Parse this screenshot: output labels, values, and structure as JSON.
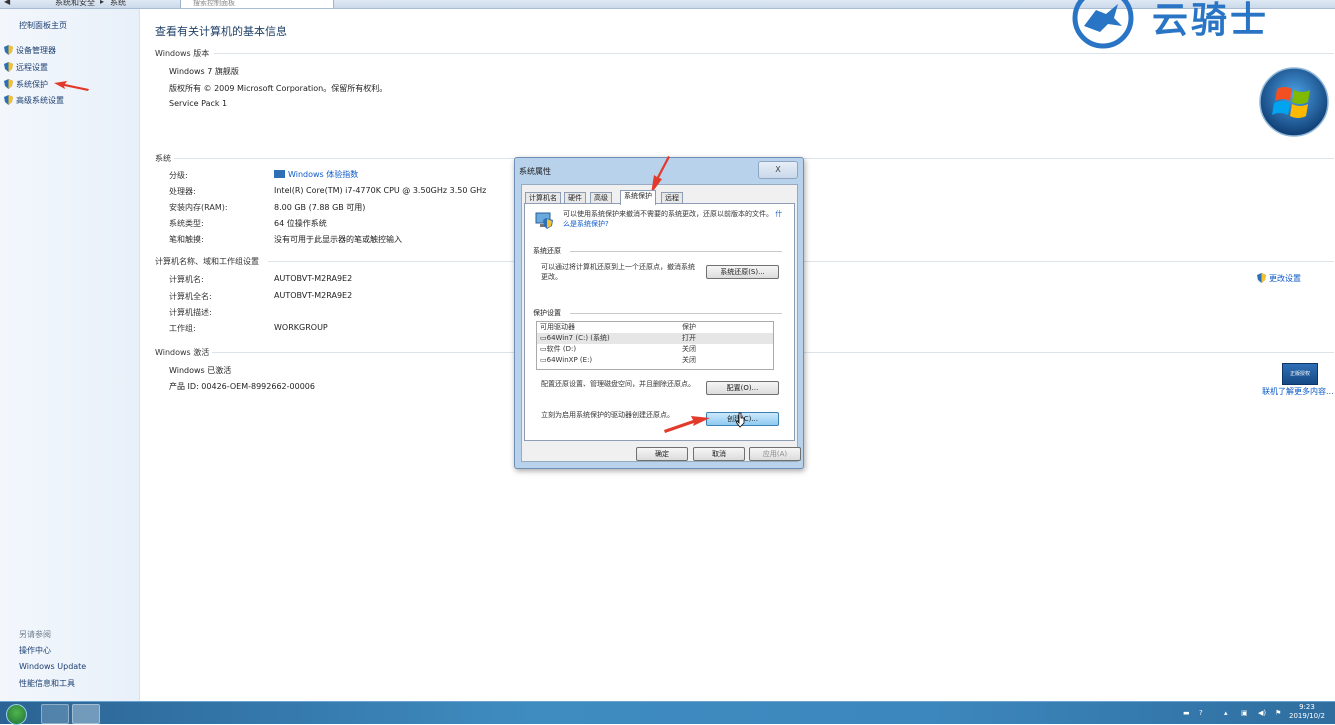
{
  "address_bar": {
    "crumb_system_security": "系统和安全",
    "crumb_system": "系统",
    "search_placeholder": "搜索控制面板"
  },
  "sidebar": {
    "home": "控制面板主页",
    "items": [
      {
        "label": "设备管理器"
      },
      {
        "label": "远程设置"
      },
      {
        "label": "系统保护"
      },
      {
        "label": "高级系统设置"
      }
    ],
    "see_also_title": "另请参阅",
    "see_also": [
      {
        "label": "操作中心"
      },
      {
        "label": "Windows Update"
      },
      {
        "label": "性能信息和工具"
      }
    ]
  },
  "main": {
    "title": "查看有关计算机的基本信息",
    "edition": {
      "heading": "Windows 版本",
      "name": "Windows 7 旗舰版",
      "copyright": "版权所有 © 2009 Microsoft Corporation。保留所有权利。",
      "sp": "Service Pack 1"
    },
    "system": {
      "heading": "系统",
      "rows": [
        {
          "label": "分级:",
          "value": "Windows 体验指数"
        },
        {
          "label": "处理器:",
          "value": "Intel(R) Core(TM) i7-4770K CPU @ 3.50GHz   3.50 GHz"
        },
        {
          "label": "安装内存(RAM):",
          "value": "8.00 GB (7.88 GB 可用)"
        },
        {
          "label": "系统类型:",
          "value": "64 位操作系统"
        },
        {
          "label": "笔和触摸:",
          "value": "没有可用于此显示器的笔或触控输入"
        }
      ]
    },
    "computer": {
      "heading": "计算机名称、域和工作组设置",
      "rows": [
        {
          "label": "计算机名:",
          "value": "AUTOBVT-M2RA9E2"
        },
        {
          "label": "计算机全名:",
          "value": "AUTOBVT-M2RA9E2"
        },
        {
          "label": "计算机描述:",
          "value": ""
        },
        {
          "label": "工作组:",
          "value": "WORKGROUP"
        }
      ],
      "change_settings": "更改设置"
    },
    "activation": {
      "heading": "Windows 激活",
      "status": "Windows 已激活",
      "product_id": "产品 ID: 00426-OEM-8992662-00006",
      "genuine_badge": "正版授权",
      "learn_more": "联机了解更多内容..."
    }
  },
  "dialog": {
    "title": "系统属性",
    "close": "X",
    "tabs": [
      {
        "label": "计算机名"
      },
      {
        "label": "硬件"
      },
      {
        "label": "高级"
      },
      {
        "label": "系统保护"
      },
      {
        "label": "远程"
      }
    ],
    "intro_text": "可以使用系统保护来撤消不需要的系统更改，还原以前版本的文件。",
    "intro_link": "什么是系统保护?",
    "restore": {
      "heading": "系统还原",
      "text": "可以通过将计算机还原到上一个还原点，撤消系统更改。",
      "button": "系统还原(S)..."
    },
    "protection": {
      "heading": "保护设置",
      "col_drive": "可用驱动器",
      "col_protect": "保护",
      "drives": [
        {
          "name": "64Win7 (C:) (系统)",
          "status": "打开"
        },
        {
          "name": "软件 (D:)",
          "status": "关闭"
        },
        {
          "name": "64WinXP (E:)",
          "status": "关闭"
        }
      ],
      "config_text": "配置还原设置、管理磁盘空间，并且删除还原点。",
      "config_button": "配置(O)...",
      "create_text": "立刻为启用系统保护的驱动器创建还原点。",
      "create_button": "创建(C)..."
    },
    "ok": "确定",
    "cancel": "取消",
    "apply": "应用(A)"
  },
  "taskbar": {
    "clock_time": "9:23",
    "clock_date": "2019/10/2"
  },
  "watermark": "云骑士",
  "colors": {
    "accent": "#1c3f72",
    "link": "#0b59c9",
    "arrow": "#e23a2b",
    "taskbar": "#3f8cc1"
  }
}
